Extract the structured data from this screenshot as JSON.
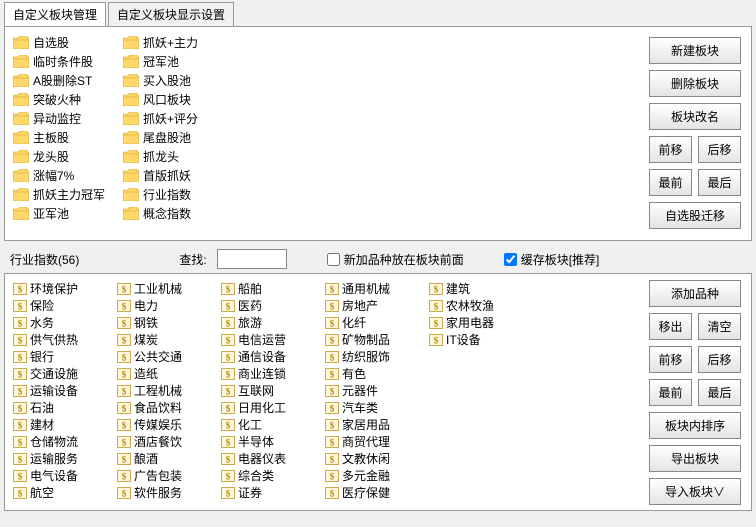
{
  "tabs": [
    {
      "label": "自定义板块管理",
      "active": true
    },
    {
      "label": "自定义板块显示设置",
      "active": false
    }
  ],
  "folders": [
    "自选股",
    "临时条件股",
    "A股删除ST",
    "突破火种",
    "异动监控",
    "主板股",
    "龙头股",
    "涨幅7%",
    "抓妖主力冠军",
    "亚军池",
    "抓妖+主力",
    "冠军池",
    "买入股池",
    "风口板块",
    "抓妖+评分",
    "尾盘股池",
    "抓龙头",
    "首版抓妖",
    "行业指数",
    "概念指数"
  ],
  "top_buttons": {
    "new": "新建板块",
    "delete": "删除板块",
    "rename": "板块改名",
    "move_up": "前移",
    "move_down": "后移",
    "move_first": "最前",
    "move_last": "最后",
    "migrate": "自选股迁移"
  },
  "filter": {
    "title": "行业指数(56)",
    "find_label": "查找:",
    "find_value": "",
    "checkbox_front": "新加品种放在板块前面",
    "checkbox_front_checked": false,
    "checkbox_cache": "缓存板块[推荐]",
    "checkbox_cache_checked": true
  },
  "stocks": [
    "环境保护",
    "保险",
    "水务",
    "供气供热",
    "银行",
    "交通设施",
    "运输设备",
    "石油",
    "建材",
    "仓储物流",
    "运输服务",
    "电气设备",
    "航空",
    "工业机械",
    "电力",
    "钢铁",
    "煤炭",
    "公共交通",
    "造纸",
    "工程机械",
    "食品饮料",
    "传媒娱乐",
    "酒店餐饮",
    "酿酒",
    "广告包装",
    "软件服务",
    "船舶",
    "医药",
    "旅游",
    "电信运营",
    "通信设备",
    "商业连锁",
    "互联网",
    "日用化工",
    "化工",
    "半导体",
    "电器仪表",
    "综合类",
    "证券",
    "通用机械",
    "房地产",
    "化纤",
    "矿物制品",
    "纺织服饰",
    "有色",
    "元器件",
    "汽车类",
    "家居用品",
    "商贸代理",
    "文教休闲",
    "多元金融",
    "医疗保健",
    "建筑",
    "农林牧渔",
    "家用电器",
    "IT设备"
  ],
  "bottom_buttons": {
    "add": "添加品种",
    "remove": "移出",
    "clear": "清空",
    "move_up": "前移",
    "move_down": "后移",
    "move_first": "最前",
    "move_last": "最后",
    "sort": "板块内排序",
    "export": "导出板块",
    "import": "导入板块∨"
  }
}
